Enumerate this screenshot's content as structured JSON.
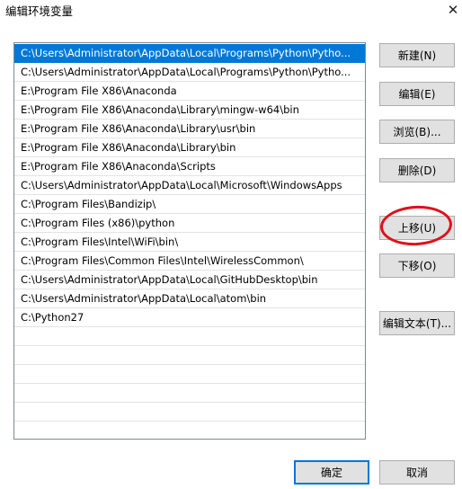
{
  "window": {
    "title": "编辑环境变量",
    "close_symbol": "✕"
  },
  "paths": [
    "C:\\Users\\Administrator\\AppData\\Local\\Programs\\Python\\Pytho...",
    "C:\\Users\\Administrator\\AppData\\Local\\Programs\\Python\\Pytho...",
    "E:\\Program File X86\\Anaconda",
    "E:\\Program File X86\\Anaconda\\Library\\mingw-w64\\bin",
    "E:\\Program File X86\\Anaconda\\Library\\usr\\bin",
    "E:\\Program File X86\\Anaconda\\Library\\bin",
    "E:\\Program File X86\\Anaconda\\Scripts",
    "C:\\Users\\Administrator\\AppData\\Local\\Microsoft\\WindowsApps",
    "C:\\Program Files\\Bandizip\\",
    "C:\\Program Files (x86)\\python",
    "C:\\Program Files\\Intel\\WiFi\\bin\\",
    "C:\\Program Files\\Common Files\\Intel\\WirelessCommon\\",
    "C:\\Users\\Administrator\\AppData\\Local\\GitHubDesktop\\bin",
    "C:\\Users\\Administrator\\AppData\\Local\\atom\\bin",
    "C:\\Python27"
  ],
  "selected_index": 0,
  "buttons": {
    "new": "新建(N)",
    "edit": "编辑(E)",
    "browse": "浏览(B)...",
    "delete": "删除(D)",
    "move_up": "上移(U)",
    "move_down": "下移(O)",
    "edit_text": "编辑文本(T)...",
    "ok": "确定",
    "cancel": "取消"
  },
  "colors": {
    "selection": "#0078d7",
    "annotation": "#e0101a"
  }
}
